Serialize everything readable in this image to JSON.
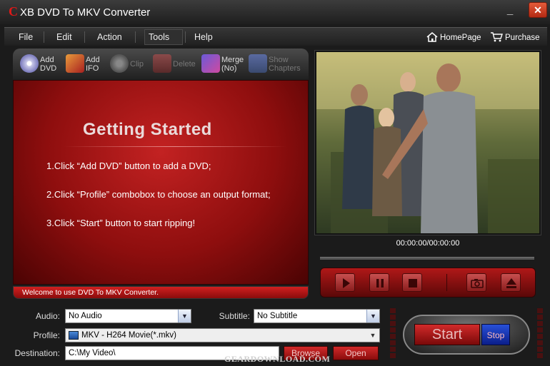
{
  "window": {
    "logo_letter": "C",
    "title": "XB DVD To MKV Converter",
    "minimize_glyph": "_",
    "close_glyph": "✕"
  },
  "menu": {
    "items": [
      "File",
      "Edit",
      "Action",
      "Tools",
      "Help"
    ],
    "homepage": "HomePage",
    "purchase": "Purchase"
  },
  "toolbar": {
    "add_dvd": [
      "Add",
      "DVD"
    ],
    "add_ifo": [
      "Add",
      "IFO"
    ],
    "clip": "Clip",
    "delete": "Delete",
    "merge": [
      "Merge",
      "(No)"
    ],
    "show_chapters": [
      "Show",
      "Chapters"
    ]
  },
  "getting_started": {
    "title": "Getting  Started",
    "steps": [
      "1.Click “Add DVD” button to add a DVD;",
      "2.Click “Profile” combobox to choose an output format;",
      "3.Click “Start” button to start ripping!"
    ]
  },
  "status": {
    "text": "Welcome to use DVD To MKV Converter."
  },
  "player": {
    "timecode": "00:00:00/00:00:00"
  },
  "form": {
    "audio_label": "Audio:",
    "audio_value": "No Audio",
    "subtitle_label": "Subtitle:",
    "subtitle_value": "No Subtitle",
    "profile_label": "Profile:",
    "profile_value": "MKV - H264 Movie(*.mkv)",
    "destination_label": "Destination:",
    "destination_value": "C:\\My Video\\",
    "browse": "Browse",
    "open": "Open"
  },
  "actions": {
    "start": "Start",
    "stop": "Stop"
  },
  "watermark": "GEARDOWNLOAD.COM",
  "colors": {
    "accent_red": "#c32222",
    "stop_blue": "#2850d8",
    "chrome_dark": "#1b1b1b"
  }
}
